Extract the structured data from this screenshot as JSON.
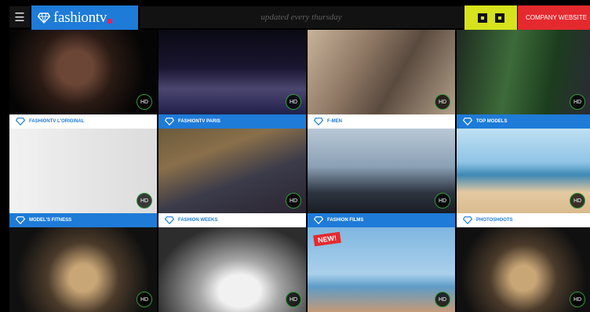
{
  "header": {
    "menu_icon": "hamburger-icon",
    "logo_text": "fashiontv",
    "tagline": "updated every thursday",
    "company_label": "COMPANY WEBSITE"
  },
  "media_controls": [
    "stop-icon",
    "pause-icon"
  ],
  "colors": {
    "accent_blue": "#1e7bd8",
    "yellow": "#d6e21c",
    "red": "#e42a2f"
  },
  "rows": [
    {
      "tiles": [
        {
          "badge": "HD"
        },
        {
          "badge": "HD"
        },
        {
          "badge": "HD"
        },
        {
          "badge": "HD"
        }
      ],
      "labels": [
        {
          "text": "FASHIONTV L'ORIGINAL",
          "style": "white"
        },
        {
          "text": "FASHIONTV PARIS",
          "style": "blue"
        },
        {
          "text": "F-MEN",
          "style": "white"
        },
        {
          "text": "TOP MODELS",
          "style": "blue"
        }
      ]
    },
    {
      "tiles": [
        {
          "badge": "HD"
        },
        {
          "badge": "HD"
        },
        {
          "badge": "HD"
        },
        {
          "badge": "HD"
        }
      ],
      "labels": [
        {
          "text": "MODEL'S FITNESS",
          "style": "blue"
        },
        {
          "text": "FASHION WEEKS",
          "style": "white"
        },
        {
          "text": "FASHION FILMS",
          "style": "blue"
        },
        {
          "text": "PHOTOSHOOTS",
          "style": "white"
        }
      ]
    },
    {
      "tiles": [
        {
          "badge": "HD"
        },
        {
          "badge": "HD"
        },
        {
          "badge": "HD",
          "new_label": "NEW!"
        },
        {
          "badge": "HD"
        }
      ]
    }
  ]
}
